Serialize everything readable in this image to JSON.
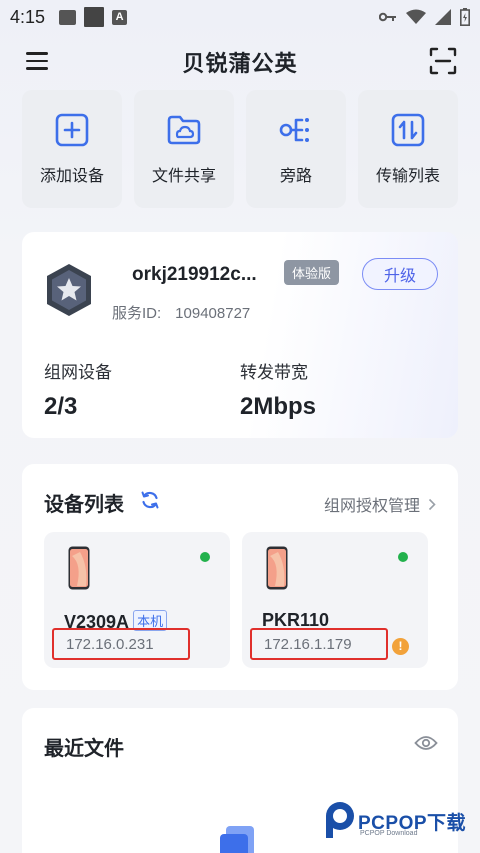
{
  "status_bar": {
    "time": "4:15",
    "a_badge": "A"
  },
  "header": {
    "title": "贝锐蒲公英"
  },
  "actions": [
    {
      "label": "添加设备",
      "icon": "add-device-icon"
    },
    {
      "label": "文件共享",
      "icon": "folder-cloud-icon"
    },
    {
      "label": "旁路",
      "icon": "bypass-icon"
    },
    {
      "label": "传输列表",
      "icon": "transfer-list-icon"
    }
  ],
  "account": {
    "name": "orkj219912c...",
    "tier": "体验版",
    "service_id_label": "服务ID:",
    "service_id": "109408727",
    "upgrade_label": "升级",
    "stats": [
      {
        "label": "组网设备",
        "value": "2/3"
      },
      {
        "label": "转发带宽",
        "value": "2Mbps"
      }
    ]
  },
  "devices": {
    "title": "设备列表",
    "manage_label": "组网授权管理",
    "items": [
      {
        "model": "V2309A",
        "local_tag": "本机",
        "ip": "172.16.0.231",
        "online": true,
        "warning": false
      },
      {
        "model": "PKR110",
        "local_tag": "",
        "ip": "172.16.1.179",
        "online": true,
        "warning": true
      }
    ]
  },
  "recent_files": {
    "title": "最近文件"
  },
  "watermark": {
    "text": "PCPOP下载",
    "sub": "PCPOP Download"
  },
  "colors": {
    "accent": "#3d6fea",
    "online": "#22b14c",
    "highlight": "#e0302c",
    "warning": "#f2a23a"
  }
}
